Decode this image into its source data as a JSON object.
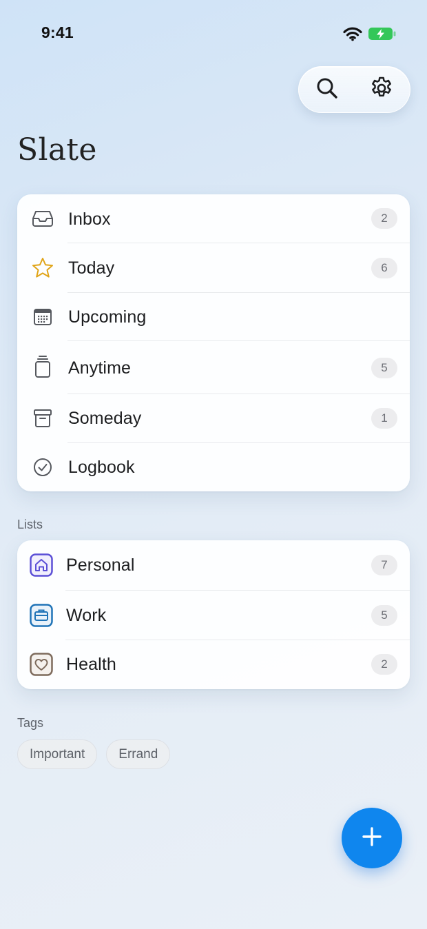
{
  "status_bar": {
    "time": "9:41"
  },
  "header": {
    "title": "Slate",
    "search_icon": "search-icon",
    "settings_icon": "gear-icon"
  },
  "main_items": [
    {
      "label": "Inbox",
      "count": "2",
      "icon": "inbox-tray-icon"
    },
    {
      "label": "Today",
      "count": "6",
      "icon": "star-icon"
    },
    {
      "label": "Upcoming",
      "count": "",
      "icon": "calendar-icon"
    },
    {
      "label": "Anytime",
      "count": "5",
      "icon": "stack-icon"
    },
    {
      "label": "Someday",
      "count": "1",
      "icon": "archive-box-icon"
    },
    {
      "label": "Logbook",
      "count": "",
      "icon": "checkmark-circle-icon"
    }
  ],
  "lists_section": {
    "label": "Lists",
    "items": [
      {
        "label": "Personal",
        "count": "7",
        "icon": "house-icon",
        "color": "#5b4fd6"
      },
      {
        "label": "Work",
        "count": "5",
        "icon": "briefcase-icon",
        "color": "#1f73b7"
      },
      {
        "label": "Health",
        "count": "2",
        "icon": "heart-icon",
        "color": "#7d6a5b"
      }
    ]
  },
  "tags_section": {
    "label": "Tags",
    "tags": [
      "Important",
      "Errand"
    ]
  },
  "fab": {
    "icon": "plus-icon",
    "color": "#0f86ee"
  },
  "colors": {
    "star": "#e0a417",
    "accent": "#0f86ee"
  }
}
